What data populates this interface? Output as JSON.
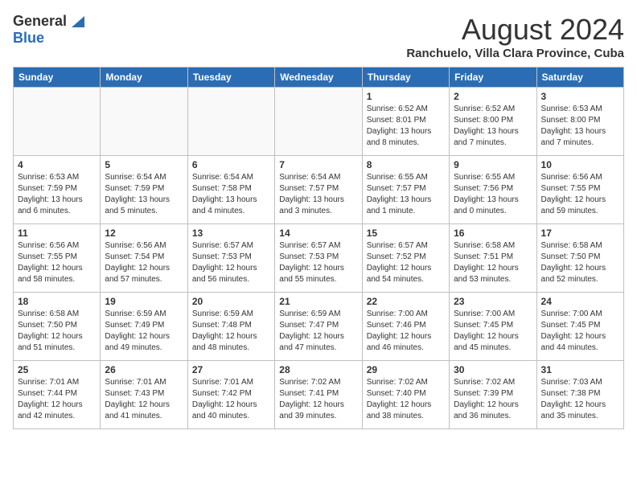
{
  "logo": {
    "general": "General",
    "blue": "Blue"
  },
  "header": {
    "month": "August 2024",
    "location": "Ranchuelo, Villa Clara Province, Cuba"
  },
  "days_of_week": [
    "Sunday",
    "Monday",
    "Tuesday",
    "Wednesday",
    "Thursday",
    "Friday",
    "Saturday"
  ],
  "weeks": [
    [
      {
        "day": "",
        "info": ""
      },
      {
        "day": "",
        "info": ""
      },
      {
        "day": "",
        "info": ""
      },
      {
        "day": "",
        "info": ""
      },
      {
        "day": "1",
        "info": "Sunrise: 6:52 AM\nSunset: 8:01 PM\nDaylight: 13 hours\nand 8 minutes."
      },
      {
        "day": "2",
        "info": "Sunrise: 6:52 AM\nSunset: 8:00 PM\nDaylight: 13 hours\nand 7 minutes."
      },
      {
        "day": "3",
        "info": "Sunrise: 6:53 AM\nSunset: 8:00 PM\nDaylight: 13 hours\nand 7 minutes."
      }
    ],
    [
      {
        "day": "4",
        "info": "Sunrise: 6:53 AM\nSunset: 7:59 PM\nDaylight: 13 hours\nand 6 minutes."
      },
      {
        "day": "5",
        "info": "Sunrise: 6:54 AM\nSunset: 7:59 PM\nDaylight: 13 hours\nand 5 minutes."
      },
      {
        "day": "6",
        "info": "Sunrise: 6:54 AM\nSunset: 7:58 PM\nDaylight: 13 hours\nand 4 minutes."
      },
      {
        "day": "7",
        "info": "Sunrise: 6:54 AM\nSunset: 7:57 PM\nDaylight: 13 hours\nand 3 minutes."
      },
      {
        "day": "8",
        "info": "Sunrise: 6:55 AM\nSunset: 7:57 PM\nDaylight: 13 hours\nand 1 minute."
      },
      {
        "day": "9",
        "info": "Sunrise: 6:55 AM\nSunset: 7:56 PM\nDaylight: 13 hours\nand 0 minutes."
      },
      {
        "day": "10",
        "info": "Sunrise: 6:56 AM\nSunset: 7:55 PM\nDaylight: 12 hours\nand 59 minutes."
      }
    ],
    [
      {
        "day": "11",
        "info": "Sunrise: 6:56 AM\nSunset: 7:55 PM\nDaylight: 12 hours\nand 58 minutes."
      },
      {
        "day": "12",
        "info": "Sunrise: 6:56 AM\nSunset: 7:54 PM\nDaylight: 12 hours\nand 57 minutes."
      },
      {
        "day": "13",
        "info": "Sunrise: 6:57 AM\nSunset: 7:53 PM\nDaylight: 12 hours\nand 56 minutes."
      },
      {
        "day": "14",
        "info": "Sunrise: 6:57 AM\nSunset: 7:53 PM\nDaylight: 12 hours\nand 55 minutes."
      },
      {
        "day": "15",
        "info": "Sunrise: 6:57 AM\nSunset: 7:52 PM\nDaylight: 12 hours\nand 54 minutes."
      },
      {
        "day": "16",
        "info": "Sunrise: 6:58 AM\nSunset: 7:51 PM\nDaylight: 12 hours\nand 53 minutes."
      },
      {
        "day": "17",
        "info": "Sunrise: 6:58 AM\nSunset: 7:50 PM\nDaylight: 12 hours\nand 52 minutes."
      }
    ],
    [
      {
        "day": "18",
        "info": "Sunrise: 6:58 AM\nSunset: 7:50 PM\nDaylight: 12 hours\nand 51 minutes."
      },
      {
        "day": "19",
        "info": "Sunrise: 6:59 AM\nSunset: 7:49 PM\nDaylight: 12 hours\nand 49 minutes."
      },
      {
        "day": "20",
        "info": "Sunrise: 6:59 AM\nSunset: 7:48 PM\nDaylight: 12 hours\nand 48 minutes."
      },
      {
        "day": "21",
        "info": "Sunrise: 6:59 AM\nSunset: 7:47 PM\nDaylight: 12 hours\nand 47 minutes."
      },
      {
        "day": "22",
        "info": "Sunrise: 7:00 AM\nSunset: 7:46 PM\nDaylight: 12 hours\nand 46 minutes."
      },
      {
        "day": "23",
        "info": "Sunrise: 7:00 AM\nSunset: 7:45 PM\nDaylight: 12 hours\nand 45 minutes."
      },
      {
        "day": "24",
        "info": "Sunrise: 7:00 AM\nSunset: 7:45 PM\nDaylight: 12 hours\nand 44 minutes."
      }
    ],
    [
      {
        "day": "25",
        "info": "Sunrise: 7:01 AM\nSunset: 7:44 PM\nDaylight: 12 hours\nand 42 minutes."
      },
      {
        "day": "26",
        "info": "Sunrise: 7:01 AM\nSunset: 7:43 PM\nDaylight: 12 hours\nand 41 minutes."
      },
      {
        "day": "27",
        "info": "Sunrise: 7:01 AM\nSunset: 7:42 PM\nDaylight: 12 hours\nand 40 minutes."
      },
      {
        "day": "28",
        "info": "Sunrise: 7:02 AM\nSunset: 7:41 PM\nDaylight: 12 hours\nand 39 minutes."
      },
      {
        "day": "29",
        "info": "Sunrise: 7:02 AM\nSunset: 7:40 PM\nDaylight: 12 hours\nand 38 minutes."
      },
      {
        "day": "30",
        "info": "Sunrise: 7:02 AM\nSunset: 7:39 PM\nDaylight: 12 hours\nand 36 minutes."
      },
      {
        "day": "31",
        "info": "Sunrise: 7:03 AM\nSunset: 7:38 PM\nDaylight: 12 hours\nand 35 minutes."
      }
    ]
  ]
}
